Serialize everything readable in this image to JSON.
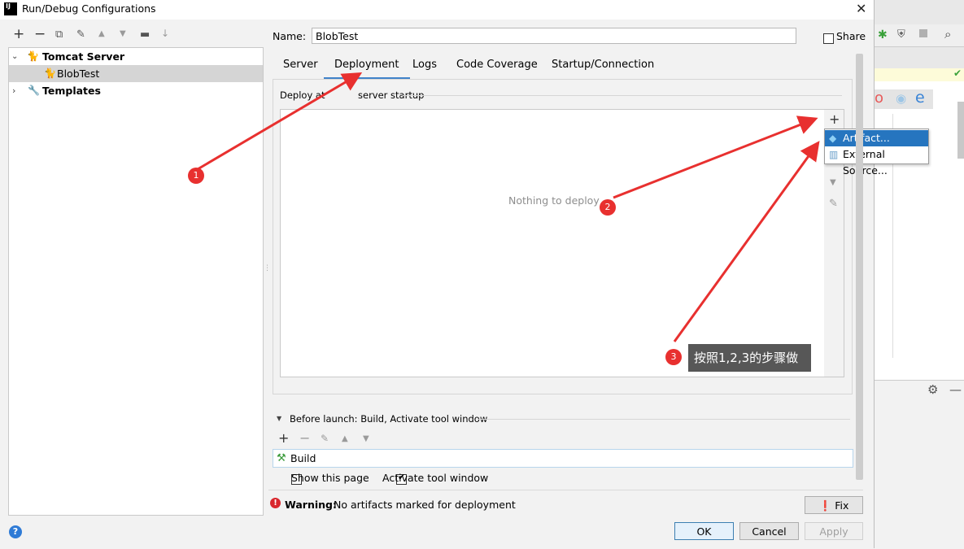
{
  "window": {
    "title": "Run/Debug Configurations",
    "close_glyph": "✕",
    "app_icon": "IJ"
  },
  "left_toolbar": {
    "icons": [
      "add-icon",
      "remove-icon",
      "copy-icon",
      "wrench-icon",
      "move-up-icon",
      "move-down-icon",
      "folder-icon",
      "sort-icon"
    ],
    "glyphs": [
      "+",
      "−",
      "⧉",
      "🔧",
      "▲",
      "▼",
      "▸",
      "↓"
    ]
  },
  "tree": {
    "tomcat_label": "Tomcat Server",
    "blobtest_label": "BlobTest",
    "templates_label": "Templates"
  },
  "name_field": {
    "label": "Name:",
    "value": "BlobTest"
  },
  "share": {
    "label": "Share"
  },
  "tabs": [
    {
      "label": "Server"
    },
    {
      "label": "Deployment"
    },
    {
      "label": "Logs"
    },
    {
      "label": "Code Coverage"
    },
    {
      "label": "Startup/Connection"
    }
  ],
  "deploy": {
    "section_label_prefix": "Deploy at",
    "section_label_suffix": "server startup",
    "empty_text": "Nothing to deploy",
    "add_glyph": "+"
  },
  "popup": {
    "items": [
      {
        "label": "Artifact..."
      },
      {
        "label": "External Source..."
      }
    ]
  },
  "annotation": {
    "badges": [
      "1",
      "2",
      "3"
    ],
    "tooltip": "按照1,2,3的步骤做",
    "arrow_color": "#e8302f"
  },
  "before_launch": {
    "title": "Before launch: Build, Activate tool window",
    "build_label": "Build",
    "show_page_label": "Show this page",
    "activate_label": "Activate tool window",
    "show_page_checked": false,
    "activate_checked": true
  },
  "warning": {
    "bold": "Warning:",
    "text": "No artifacts marked for deployment"
  },
  "buttons": {
    "fix": "Fix",
    "ok": "OK",
    "cancel": "Cancel",
    "apply": "Apply"
  },
  "help_glyph": "?"
}
